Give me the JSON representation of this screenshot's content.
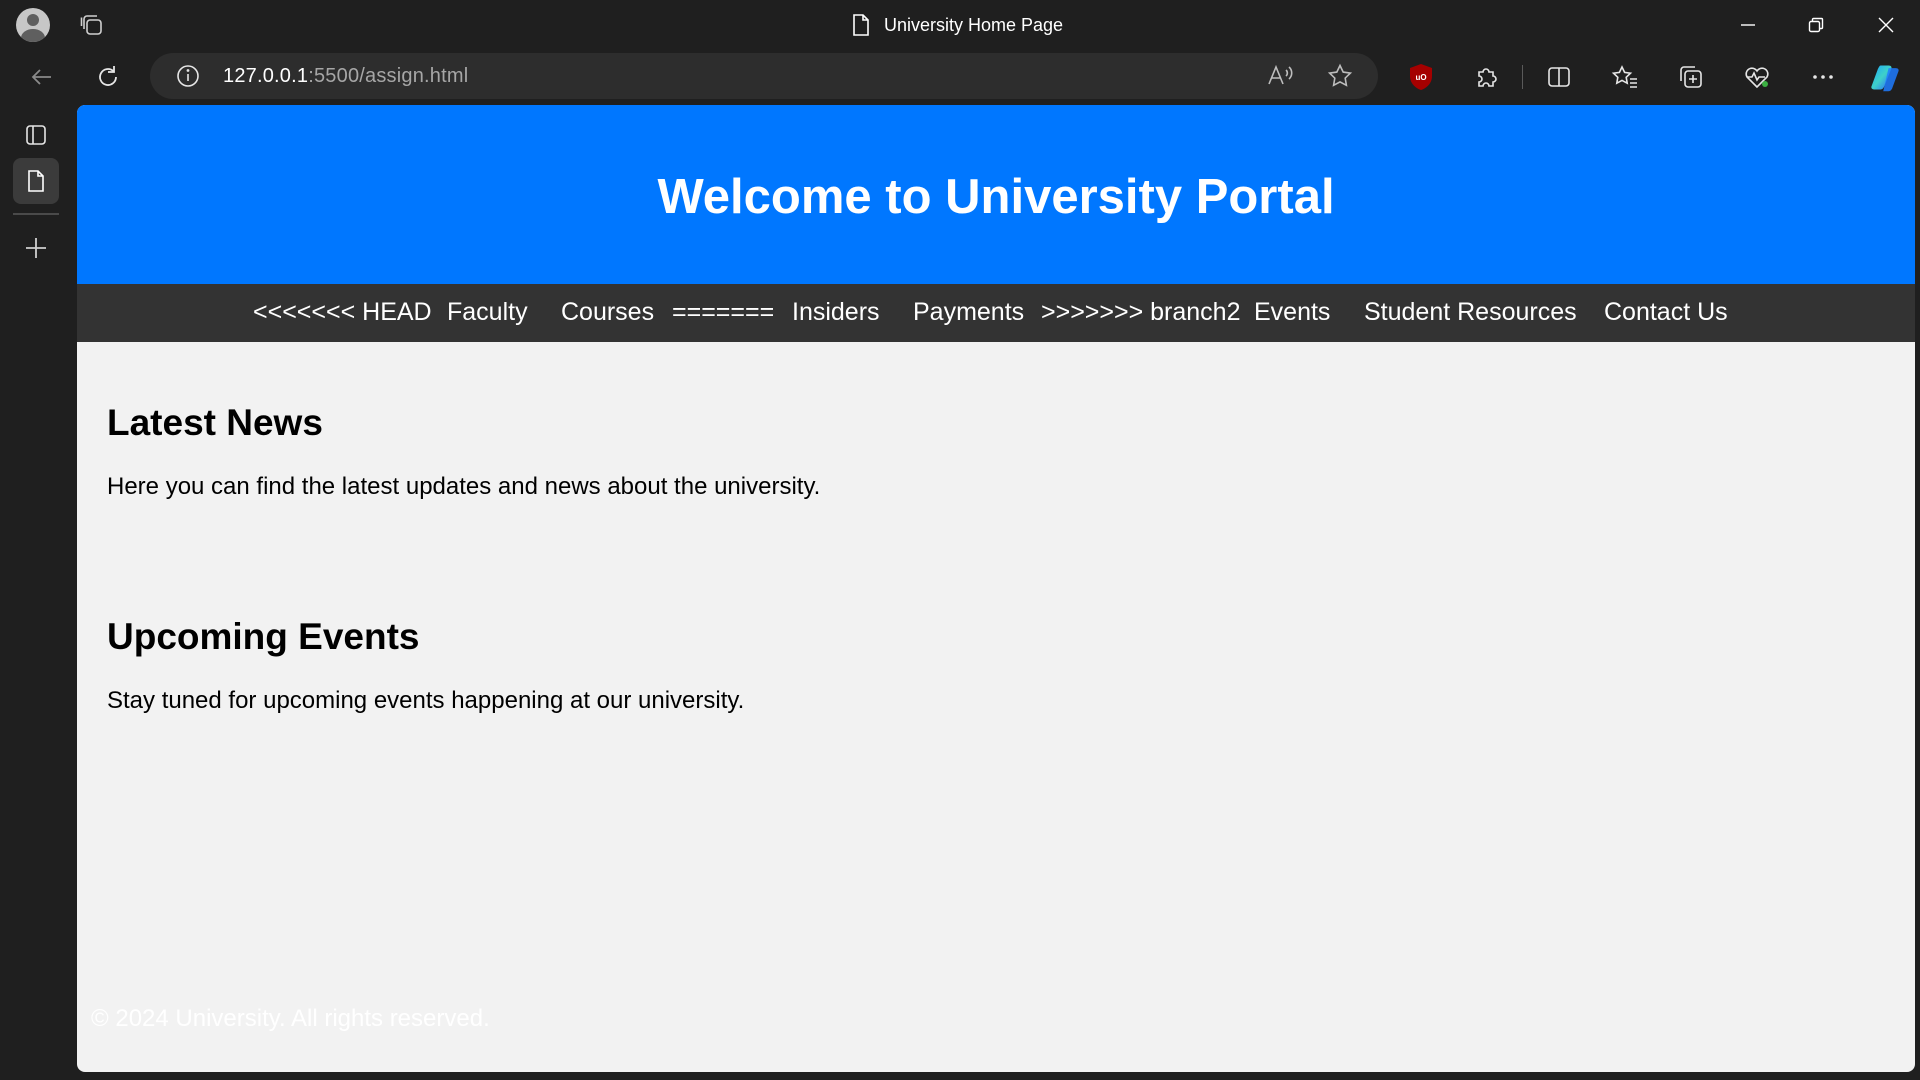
{
  "browser": {
    "tab_title": "University Home Page",
    "url_host": "127.0.0.1",
    "url_rest": ":5500/assign.html"
  },
  "colors": {
    "header_bg": "#0077ff",
    "nav_bg": "#333333",
    "page_bg": "#f2f2f2",
    "chrome_bg": "#1f1f1f"
  },
  "page": {
    "header_title": "Welcome to University Portal",
    "nav": [
      "<<<<<<< HEAD",
      "Faculty",
      "Courses",
      "=======",
      "Insiders",
      "Payments",
      ">>>>>>> branch2",
      "Events",
      "Student Resources",
      "Contact Us"
    ],
    "news": {
      "heading": "Latest News",
      "text": "Here you can find the latest updates and news about the university."
    },
    "events": {
      "heading": "Upcoming Events",
      "text": "Stay tuned for upcoming events happening at our university."
    },
    "footer": "© 2024 University. All rights reserved."
  }
}
